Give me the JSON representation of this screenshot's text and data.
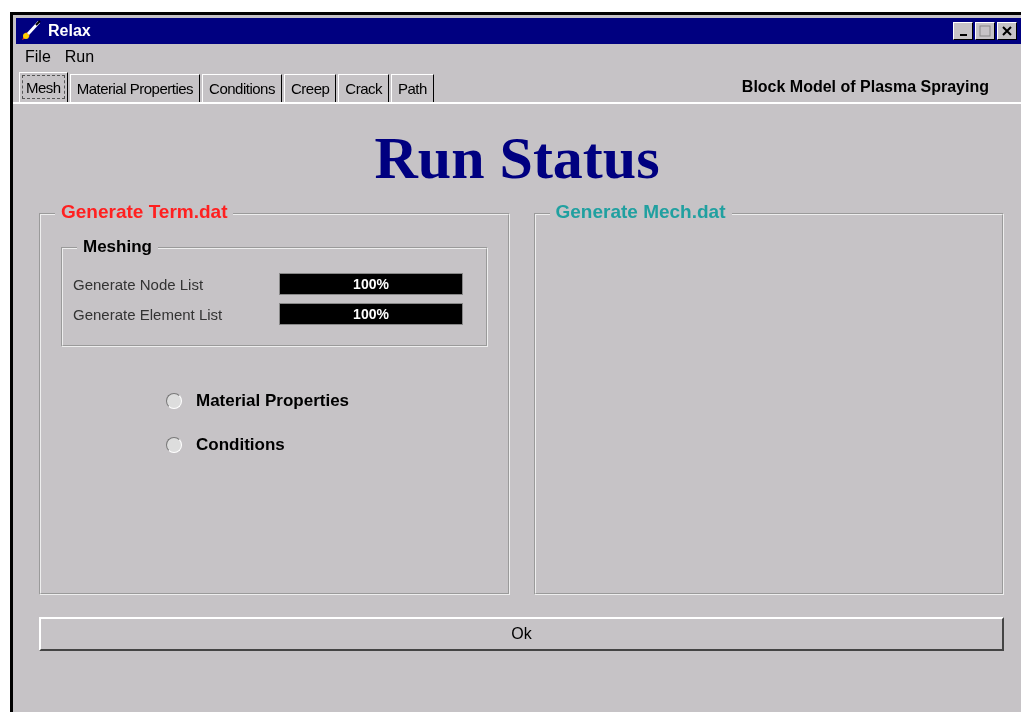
{
  "window": {
    "title": "Relax"
  },
  "menu": [
    "File",
    "Run"
  ],
  "tabs": [
    {
      "label": "Mesh",
      "selected": true
    },
    {
      "label": "Material Properties",
      "selected": false
    },
    {
      "label": "Conditions",
      "selected": false
    },
    {
      "label": "Creep",
      "selected": false
    },
    {
      "label": "Crack",
      "selected": false
    },
    {
      "label": "Path",
      "selected": false
    }
  ],
  "header_caption": "Block Model of Plasma Spraying",
  "heading": "Run Status",
  "left_group": {
    "title": "Generate Term.dat",
    "color": "#ff2020",
    "meshing": {
      "title": "Meshing",
      "tasks": [
        {
          "label": "Generate Node List",
          "level": 1,
          "reading": "100%"
        },
        {
          "label": "Generate Element List",
          "level": 1,
          "reading": "100%"
        }
      ]
    },
    "options": [
      {
        "label": "Material Properties",
        "selected": false
      },
      {
        "label": "Conditions",
        "selected": false
      }
    ]
  },
  "right_group": {
    "title": "Generate Mech.dat",
    "color": "#20a0a0"
  },
  "ok_button": "Ok"
}
